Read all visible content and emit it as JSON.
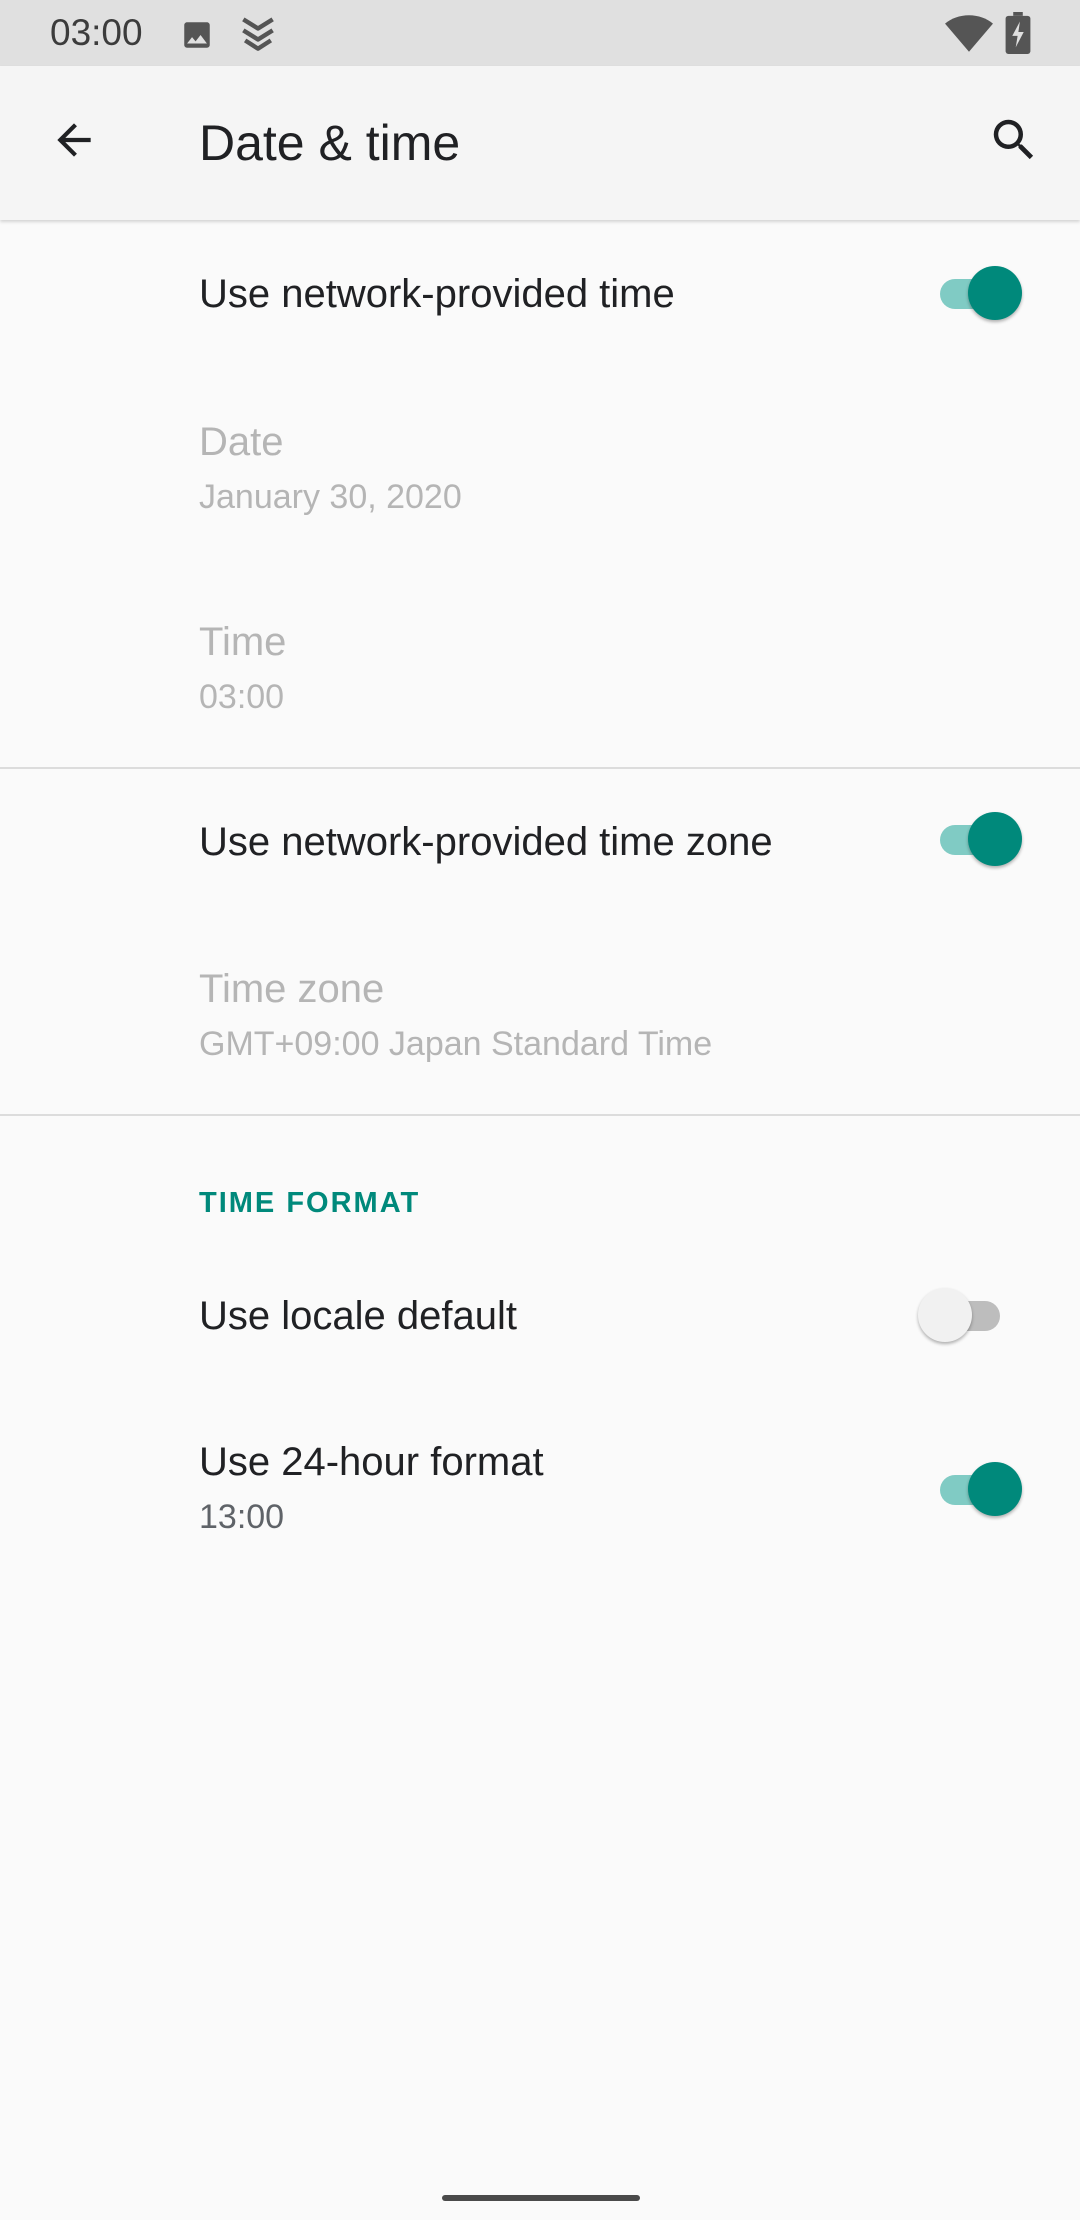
{
  "status_bar": {
    "time": "03:00",
    "icons": [
      "image-icon",
      "shield-app-icon",
      "wifi-icon",
      "battery-charging-icon"
    ]
  },
  "app_bar": {
    "title": "Date & time",
    "back_icon": "arrow-back-icon",
    "search_icon": "search-icon"
  },
  "settings": {
    "network_time": {
      "title": "Use network-provided time",
      "enabled": true
    },
    "date": {
      "title": "Date",
      "summary": "January 30, 2020"
    },
    "time": {
      "title": "Time",
      "summary": "03:00"
    },
    "network_time_zone": {
      "title": "Use network-provided time zone",
      "enabled": true
    },
    "time_zone": {
      "title": "Time zone",
      "summary": "GMT+09:00 Japan Standard Time"
    },
    "time_format_category": "TIME FORMAT",
    "locale_default": {
      "title": "Use locale default",
      "enabled": false
    },
    "hour_24": {
      "title": "Use 24-hour format",
      "summary": "13:00",
      "enabled": true
    }
  },
  "colors": {
    "accent": "#00897b",
    "accent_track": "#80cbc4",
    "disabled_text": "#b5b5b5"
  }
}
